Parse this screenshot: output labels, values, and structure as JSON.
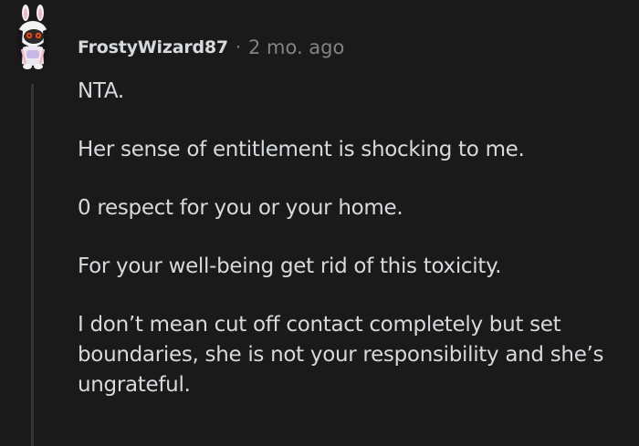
{
  "comment": {
    "author": "FrostyWizard87",
    "separator": "·",
    "timestamp": "2 mo. ago",
    "avatar_icon": "snoo-bunny-avatar-icon",
    "paragraphs": [
      "NTA.",
      "Her sense of entitlement is shocking to me.",
      "0 respect for you or your home.",
      "For your well-being get rid of this toxicity.",
      "I don’t mean cut off contact completely but set boundaries, she is not your responsibility and she’s ungrateful."
    ]
  },
  "colors": {
    "background": "#1a1a1b",
    "text": "#d7dadc",
    "meta": "#818384",
    "thread_line": "#343536"
  }
}
